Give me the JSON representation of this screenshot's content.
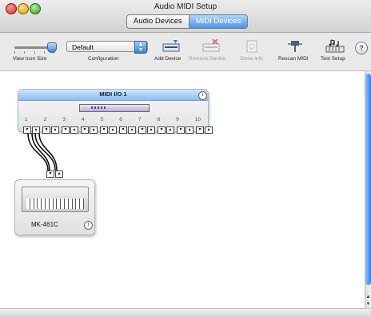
{
  "window": {
    "title": "Audio MIDI Setup"
  },
  "tabs": [
    {
      "label": "Audio Devices",
      "selected": false
    },
    {
      "label": "MIDI Devices",
      "selected": true
    }
  ],
  "toolbar": {
    "icon_size_label": "View Icon Size",
    "configuration_label": "Configuration",
    "configuration_value": "Default",
    "buttons": [
      {
        "label": "Add Device",
        "enabled": true,
        "icon": "add-device-icon"
      },
      {
        "label": "Remove Device",
        "enabled": false,
        "icon": "remove-device-icon"
      },
      {
        "label": "Show Info",
        "enabled": false,
        "icon": "show-info-icon"
      },
      {
        "label": "Rescan MIDI",
        "enabled": true,
        "icon": "rescan-midi-icon"
      },
      {
        "label": "Test Setup",
        "enabled": true,
        "icon": "test-setup-icon"
      }
    ],
    "help": "?"
  },
  "devices": [
    {
      "name": "MIDI I/O 1",
      "ports": [
        "1",
        "2",
        "3",
        "4",
        "5",
        "6",
        "7",
        "8",
        "9",
        "10"
      ]
    },
    {
      "name": "MK-461C"
    }
  ],
  "colors": {
    "accent": "#4b94e6",
    "device_header": "#8fbcf0"
  }
}
